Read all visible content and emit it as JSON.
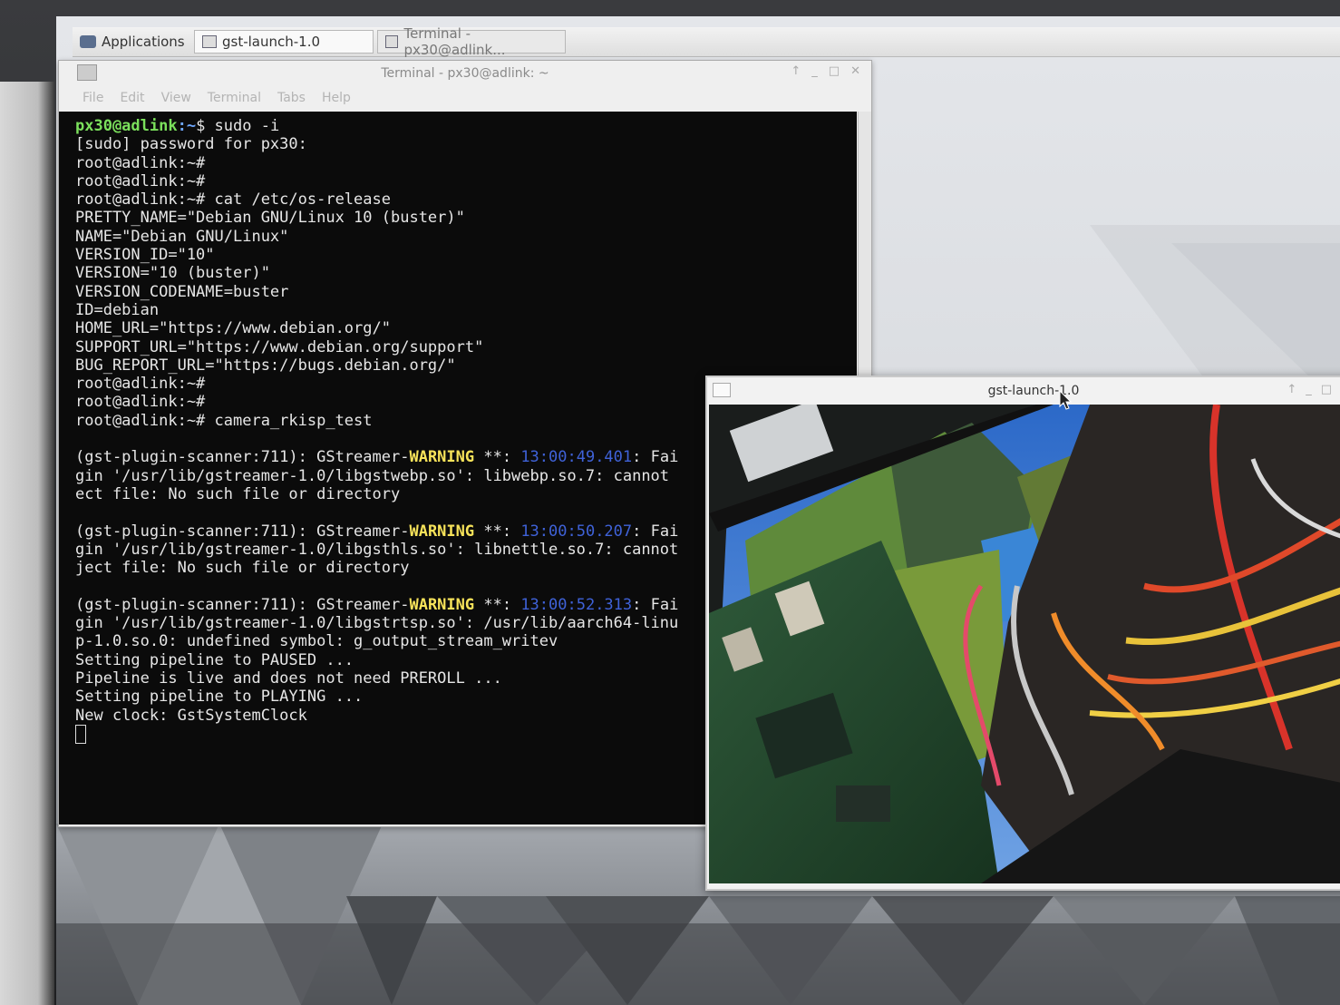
{
  "panel": {
    "apps_label": "Applications",
    "tasks": [
      {
        "label": "gst-launch-1.0"
      },
      {
        "label": "Terminal - px30@adlink..."
      }
    ]
  },
  "terminal": {
    "title": "Terminal - px30@adlink: ~",
    "menu": [
      "File",
      "Edit",
      "View",
      "Terminal",
      "Tabs",
      "Help"
    ],
    "lines": [
      {
        "user": "px30@adlink",
        "path": ":~",
        "rest": "$ sudo -i"
      },
      {
        "text": "[sudo] password for px30:"
      },
      {
        "text": "root@adlink:~#"
      },
      {
        "text": "root@adlink:~#"
      },
      {
        "text": "root@adlink:~# cat /etc/os-release"
      },
      {
        "text": "PRETTY_NAME=\"Debian GNU/Linux 10 (buster)\""
      },
      {
        "text": "NAME=\"Debian GNU/Linux\""
      },
      {
        "text": "VERSION_ID=\"10\""
      },
      {
        "text": "VERSION=\"10 (buster)\""
      },
      {
        "text": "VERSION_CODENAME=buster"
      },
      {
        "text": "ID=debian"
      },
      {
        "text": "HOME_URL=\"https://www.debian.org/\""
      },
      {
        "text": "SUPPORT_URL=\"https://www.debian.org/support\""
      },
      {
        "text": "BUG_REPORT_URL=\"https://bugs.debian.org/\""
      },
      {
        "text": "root@adlink:~#"
      },
      {
        "text": "root@adlink:~#"
      },
      {
        "text": "root@adlink:~# camera_rkisp_test"
      },
      {
        "text": ""
      },
      {
        "pre": "(gst-plugin-scanner:711): GStreamer-",
        "warn": "WARNING",
        "mid": " **: ",
        "ts": "13:00:49.401",
        "post": ": Fai"
      },
      {
        "text": "gin '/usr/lib/gstreamer-1.0/libgstwebp.so': libwebp.so.7: cannot"
      },
      {
        "text": "ect file: No such file or directory"
      },
      {
        "text": ""
      },
      {
        "pre": "(gst-plugin-scanner:711): GStreamer-",
        "warn": "WARNING",
        "mid": " **: ",
        "ts": "13:00:50.207",
        "post": ": Fai"
      },
      {
        "text": "gin '/usr/lib/gstreamer-1.0/libgsthls.so': libnettle.so.7: cannot"
      },
      {
        "text": "ject file: No such file or directory"
      },
      {
        "text": ""
      },
      {
        "pre": "(gst-plugin-scanner:711): GStreamer-",
        "warn": "WARNING",
        "mid": " **: ",
        "ts": "13:00:52.313",
        "post": ": Fai"
      },
      {
        "text": "gin '/usr/lib/gstreamer-1.0/libgstrtsp.so': /usr/lib/aarch64-linu"
      },
      {
        "text": "p-1.0.so.0: undefined symbol: g_output_stream_writev"
      },
      {
        "text": "Setting pipeline to PAUSED ..."
      },
      {
        "text": "Pipeline is live and does not need PREROLL ..."
      },
      {
        "text": "Setting pipeline to PLAYING ..."
      },
      {
        "text": "New clock: GstSystemClock"
      }
    ]
  },
  "gst_window": {
    "title": "gst-launch-1.0",
    "video_content": "camera-feed-of-board-and-cables"
  },
  "colors": {
    "prompt_user": "#7be05c",
    "warning": "#f7e35a",
    "timestamp": "#3f62d8",
    "terminal_bg": "#0b0b0b"
  }
}
